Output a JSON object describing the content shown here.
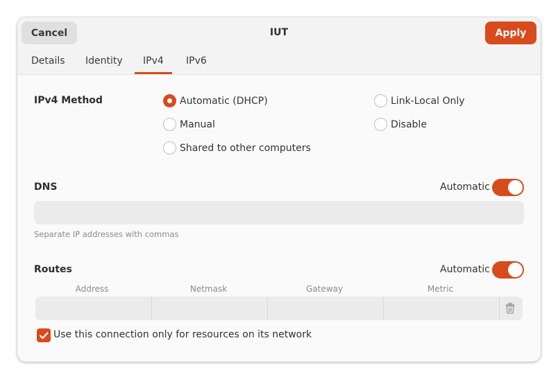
{
  "header": {
    "title": "IUT",
    "cancel_label": "Cancel",
    "apply_label": "Apply"
  },
  "tabs": [
    {
      "label": "Details",
      "active": false
    },
    {
      "label": "Identity",
      "active": false
    },
    {
      "label": "IPv4",
      "active": true
    },
    {
      "label": "IPv6",
      "active": false
    }
  ],
  "ipv4_method": {
    "label": "IPv4 Method",
    "options": [
      {
        "label": "Automatic (DHCP)",
        "checked": true
      },
      {
        "label": "Manual",
        "checked": false
      },
      {
        "label": "Shared to other computers",
        "checked": false
      },
      {
        "label": "Link-Local Only",
        "checked": false
      },
      {
        "label": "Disable",
        "checked": false
      }
    ]
  },
  "dns": {
    "label": "DNS",
    "automatic_label": "Automatic",
    "automatic_on": true,
    "value": "",
    "hint": "Separate IP addresses with commas"
  },
  "routes": {
    "label": "Routes",
    "automatic_label": "Automatic",
    "automatic_on": true,
    "columns": [
      "Address",
      "Netmask",
      "Gateway",
      "Metric"
    ],
    "row": [
      "",
      "",
      "",
      ""
    ]
  },
  "only_resources": {
    "label": "Use this connection only for resources on its network",
    "checked": true
  },
  "colors": {
    "accent": "#d74b1c",
    "field_bg": "#ebebeb"
  },
  "icons": {
    "delete_route": "trash-icon",
    "checkbox_mark": "checkmark-icon"
  }
}
